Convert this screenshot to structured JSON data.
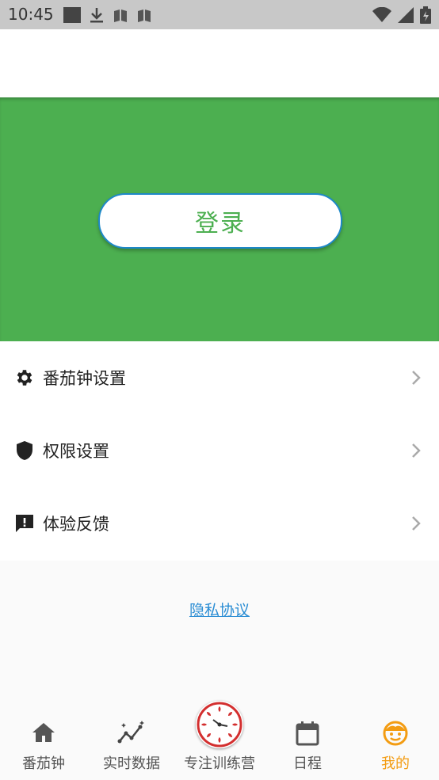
{
  "status_bar": {
    "time": "10:45"
  },
  "hero": {
    "login_label": "登录"
  },
  "menu": {
    "items": [
      {
        "label": "番茄钟设置",
        "icon": "gear-icon"
      },
      {
        "label": "权限设置",
        "icon": "shield-icon"
      },
      {
        "label": "体验反馈",
        "icon": "feedback-icon"
      }
    ]
  },
  "privacy": {
    "label": "隐私协议"
  },
  "bottom_nav": {
    "items": [
      {
        "label": "番茄钟",
        "icon": "home-icon"
      },
      {
        "label": "实时数据",
        "icon": "sparkline-icon"
      },
      {
        "label": "专注训练营",
        "icon": "clock-dial-icon"
      },
      {
        "label": "日程",
        "icon": "calendar-icon"
      },
      {
        "label": "我的",
        "icon": "smiley-icon",
        "active": true
      }
    ]
  },
  "colors": {
    "hero_green": "#4caf50",
    "accent_orange": "#f39c12",
    "link_blue": "#2a8dd4",
    "button_border": "#1e88c8"
  }
}
